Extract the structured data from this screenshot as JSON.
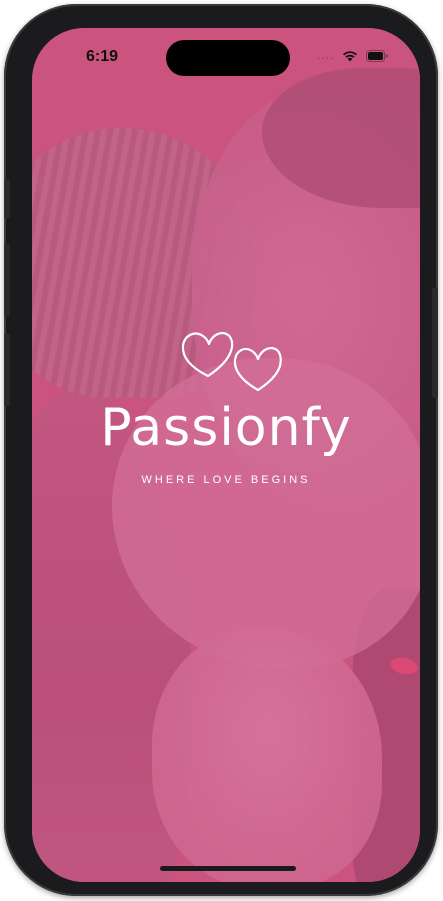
{
  "status_bar": {
    "time": "6:19",
    "signal": "....",
    "wifi_icon": "wifi-icon",
    "battery_icon": "battery-icon"
  },
  "splash": {
    "logo_icon": "two-hearts-icon",
    "app_name": "Passionfy",
    "tagline": "WHERE LOVE BEGINS"
  },
  "colors": {
    "overlay_pink": "#c8577f",
    "text": "#ffffff",
    "frame": "#1b1b1d"
  }
}
